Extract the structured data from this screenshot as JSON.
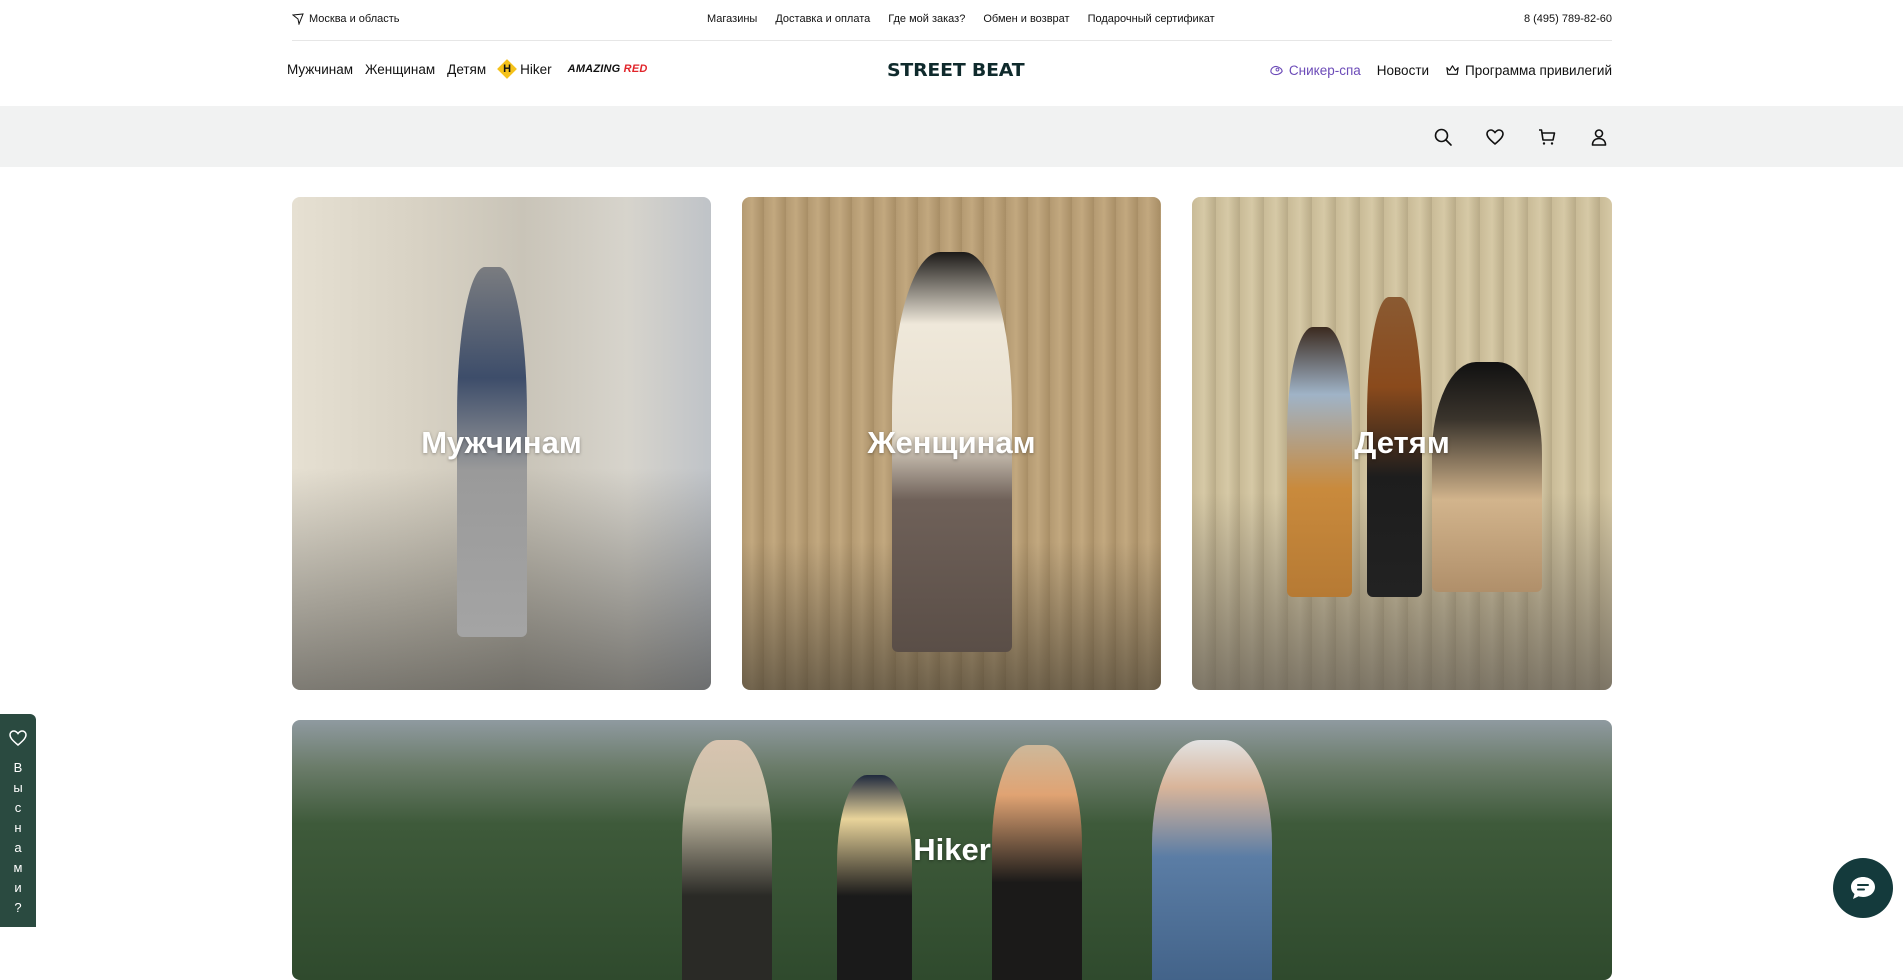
{
  "topbar": {
    "region": "Москва и область",
    "links": [
      "Магазины",
      "Доставка и оплата",
      "Где мой заказ?",
      "Обмен и возврат",
      "Подарочный сертификат"
    ],
    "phone": "8 (495) 789-82-60"
  },
  "header": {
    "nav": [
      "Мужчинам",
      "Женщинам",
      "Детям"
    ],
    "hiker": "Hiker",
    "hiker_logo_letter": "H",
    "amazing": "AMAZING",
    "amazing_red": "RED",
    "logo": "STREET BEAT",
    "right_nav": {
      "sneaker_spa": "Сникер-спа",
      "news": "Новости",
      "privileges": "Программа привилегий"
    }
  },
  "icons": [
    "search-icon",
    "heart-icon",
    "cart-icon",
    "user-icon"
  ],
  "tiles": {
    "men": "Мужчинам",
    "women": "Женщинам",
    "kids": "Детям",
    "hiker": "Hiker"
  },
  "side_widget": {
    "letters": [
      "В",
      "ы",
      "с",
      "н",
      "а",
      "м",
      "и",
      "?"
    ]
  },
  "colors": {
    "accent_purple": "#6c4bb8",
    "brand_dark": "#0f2a2c",
    "amazing_red": "#e1252b",
    "widget_green": "#2a4a40",
    "chat_bg": "#143a3c"
  }
}
